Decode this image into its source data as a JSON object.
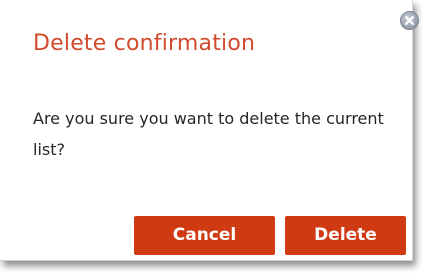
{
  "dialog": {
    "title": "Delete confirmation",
    "message": "Are you sure you want to delete the current list?",
    "close_icon": "close-icon",
    "buttons": {
      "cancel_label": "Cancel",
      "delete_label": "Delete"
    }
  },
  "colors": {
    "title": "#d14b2e",
    "button_background": "#cf3a12",
    "button_text": "#ffffff",
    "message_text": "#262626",
    "close_icon": "#9aa3b0"
  }
}
